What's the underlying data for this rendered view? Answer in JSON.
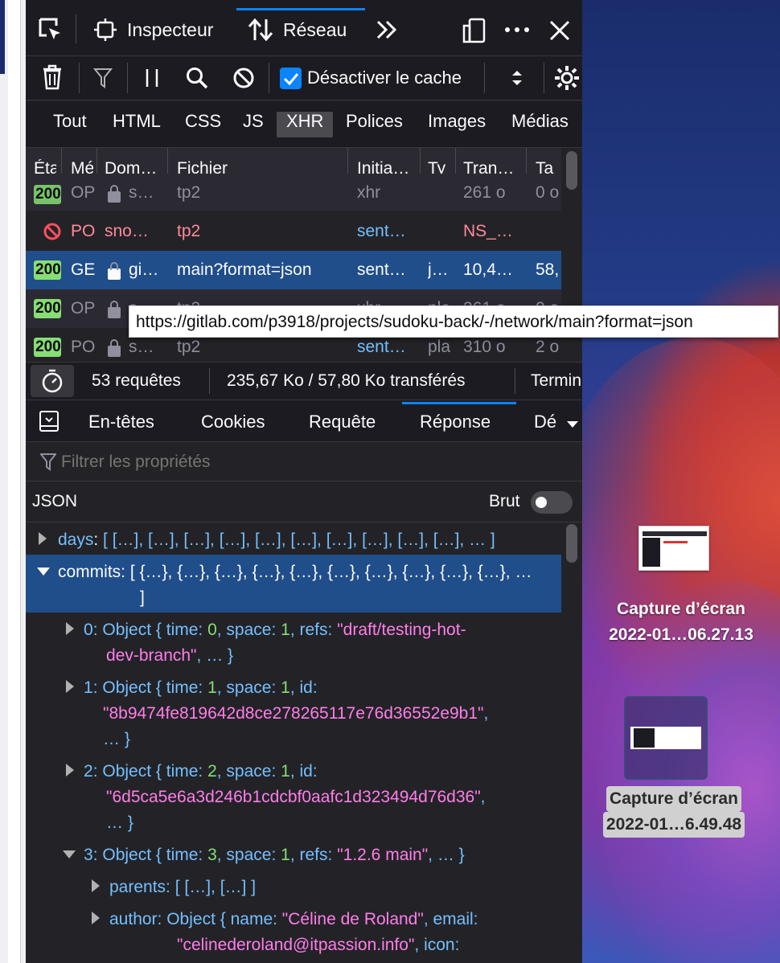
{
  "toolbar": {
    "inspector_label": "Inspecteur",
    "network_label": "Réseau",
    "disable_cache_label": "Désactiver le cache"
  },
  "filters": [
    "Tout",
    "HTML",
    "CSS",
    "JS",
    "XHR",
    "Polices",
    "Images",
    "Médias"
  ],
  "columns": [
    "Éta",
    "Mé",
    "Dom…",
    "Fichier",
    "Initia…",
    "Ty",
    "Tran…",
    "Ta"
  ],
  "rows": [
    {
      "status": "200",
      "method": "OP",
      "domain": "s…",
      "file": "tp2",
      "initiator": "xhr",
      "type": "",
      "transferred": "261 o",
      "size": "0 o"
    },
    {
      "status": "",
      "method": "PO",
      "domain": "sno…",
      "file": "tp2",
      "initiator": "sent…",
      "type": "",
      "transferred": "NS_…",
      "size": ""
    },
    {
      "status": "200",
      "method": "GE",
      "domain": "gi…",
      "file": "main?format=json",
      "initiator": "sent…",
      "type": "j…",
      "transferred": "10,4…",
      "size": "58,"
    },
    {
      "status": "200",
      "method": "OP",
      "domain": "s…",
      "file": "tp2",
      "initiator": "xhr",
      "type": "pla",
      "transferred": "261 o",
      "size": "0 o"
    },
    {
      "status": "200",
      "method": "PO",
      "domain": "s…",
      "file": "tp2",
      "initiator": "sent…",
      "type": "pla",
      "transferred": "310 o",
      "size": "2 o"
    }
  ],
  "tooltip": "https://gitlab.com/p3918/projects/sudoku-back/-/network/main?format=json",
  "status_bar": {
    "requests": "53 requêtes",
    "transferred": "235,67 Ko / 57,80 Ko transférés",
    "finished": "Termin"
  },
  "detail_tabs": [
    "En-têtes",
    "Cookies",
    "Requête",
    "Réponse",
    "Dé"
  ],
  "filter_placeholder": "Filtrer les propriétés",
  "json_label": "JSON",
  "raw_label": "Brut",
  "tree": {
    "days_key": "days",
    "days_val": "[ […], […], […], […], […], […], […], […], […], […], … ]",
    "commits_key": "commits",
    "commits_val": "[ {…}, {…}, {…}, {…}, {…}, {…}, {…}, {…}, {…}, {…}, …",
    "commits_close": "]",
    "c0_index": "0",
    "c0_num_time": "0",
    "c0_num_space": "1",
    "c0_str_refs1": "\"draft/testing-hot-",
    "c0_str_refs2": "dev-branch\"",
    "c1_index": "1",
    "c1_num_time": "1",
    "c1_num_space": "1",
    "c1_id": "\"8b9474fe819642d8ce278265117e76d36552e9b1\"",
    "c2_index": "2",
    "c2_num_time": "2",
    "c2_num_space": "1",
    "c2_id": "\"6d5ca5e6a3d246b1cdcbf0aafc1d323494d76d36\"",
    "c3_index": "3",
    "c3_num_time": "3",
    "c3_num_space": "1",
    "c3_refs": "\"1.2.6 main\"",
    "parents_key": "parents",
    "parents_val": "[ […], […] ]",
    "author_key": "author",
    "author_name": "\"Céline de Roland\"",
    "author_email": "\"celinederoland@itpassion.info\""
  },
  "desktop": {
    "file1_line1": "Capture d’écran",
    "file1_line2": "2022-01…06.27.13",
    "file2_line1": "Capture d’écran",
    "file2_line2": "2022-01…6.49.48"
  },
  "colors": {
    "accent": "#0a84ff",
    "status_ok": "#86de74",
    "error": "#ff4f5e",
    "string": "#ff7de9",
    "key": "#75bfff"
  }
}
